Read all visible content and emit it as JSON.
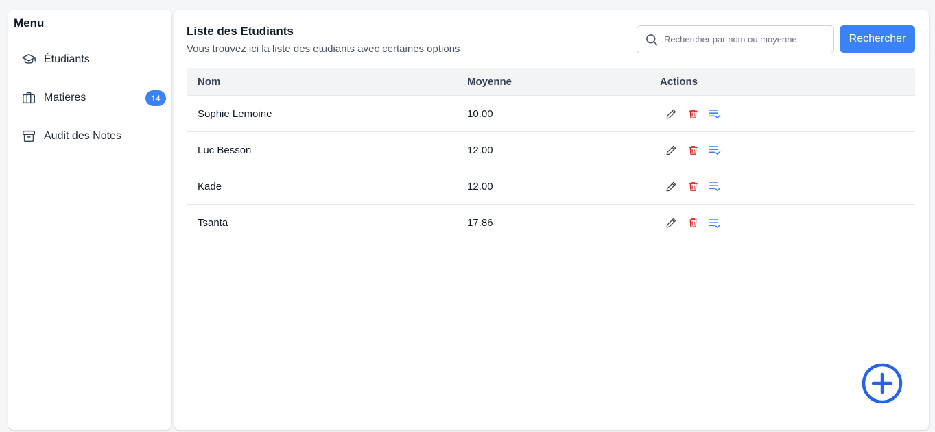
{
  "sidebar": {
    "title": "Menu",
    "items": [
      {
        "label": "Étudiants",
        "icon": "graduation-cap-icon"
      },
      {
        "label": "Matieres",
        "icon": "briefcase-icon",
        "badge": "14"
      },
      {
        "label": "Audit des Notes",
        "icon": "archive-icon"
      }
    ]
  },
  "header": {
    "title": "Liste des Etudiants",
    "subtitle": "Vous trouvez ici la liste des etudiants avec certaines options"
  },
  "search": {
    "placeholder": "Rechercher par nom ou moyenne",
    "value": "",
    "button_label": "Rechercher"
  },
  "table": {
    "columns": {
      "nom": "Nom",
      "moyenne": "Moyenne",
      "actions": "Actions"
    },
    "rows": [
      {
        "nom": "Sophie Lemoine",
        "moyenne": "10.00"
      },
      {
        "nom": "Luc Besson",
        "moyenne": "12.00"
      },
      {
        "nom": "Kade",
        "moyenne": "12.00"
      },
      {
        "nom": "Tsanta",
        "moyenne": "17.86"
      }
    ]
  },
  "colors": {
    "accent": "#3b82f6",
    "delete": "#dc2626",
    "fab": "#2563eb"
  }
}
